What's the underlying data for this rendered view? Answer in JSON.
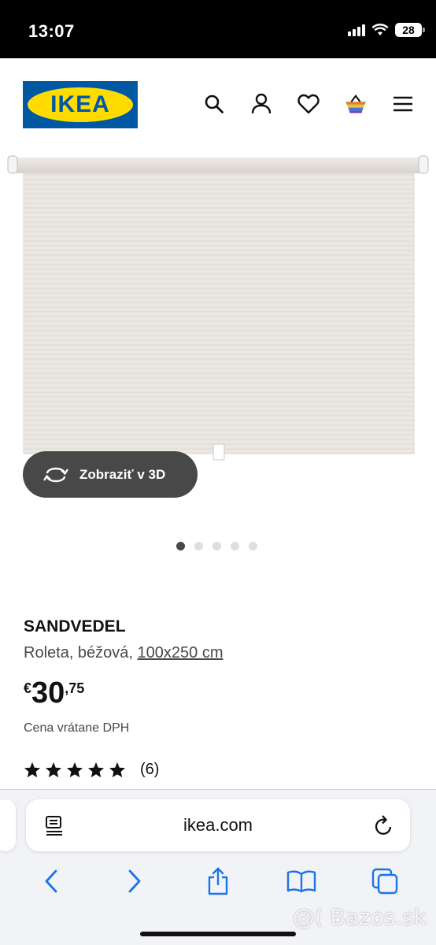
{
  "status_bar": {
    "time": "13:07",
    "battery": "28"
  },
  "header": {
    "logo_text": "IKEA"
  },
  "media": {
    "view_3d_label": "Zobraziť v 3D",
    "slide_count": 5,
    "active_slide": 1
  },
  "product": {
    "name": "SANDVEDEL",
    "description": "Roleta, béžová, ",
    "size": "100x250 cm",
    "price_currency": "€",
    "price_integer": "30",
    "price_decimal": ",75",
    "vat_note": "Cena vrátane DPH",
    "rating_stars": 5,
    "review_count": "(6)"
  },
  "browser": {
    "url": "ikea.com"
  },
  "watermark": "@( Bazos.sk",
  "colors": {
    "ikea_blue": "#0058a3",
    "ikea_yellow": "#ffdb00",
    "blind_fabric": "#e9e5df"
  }
}
